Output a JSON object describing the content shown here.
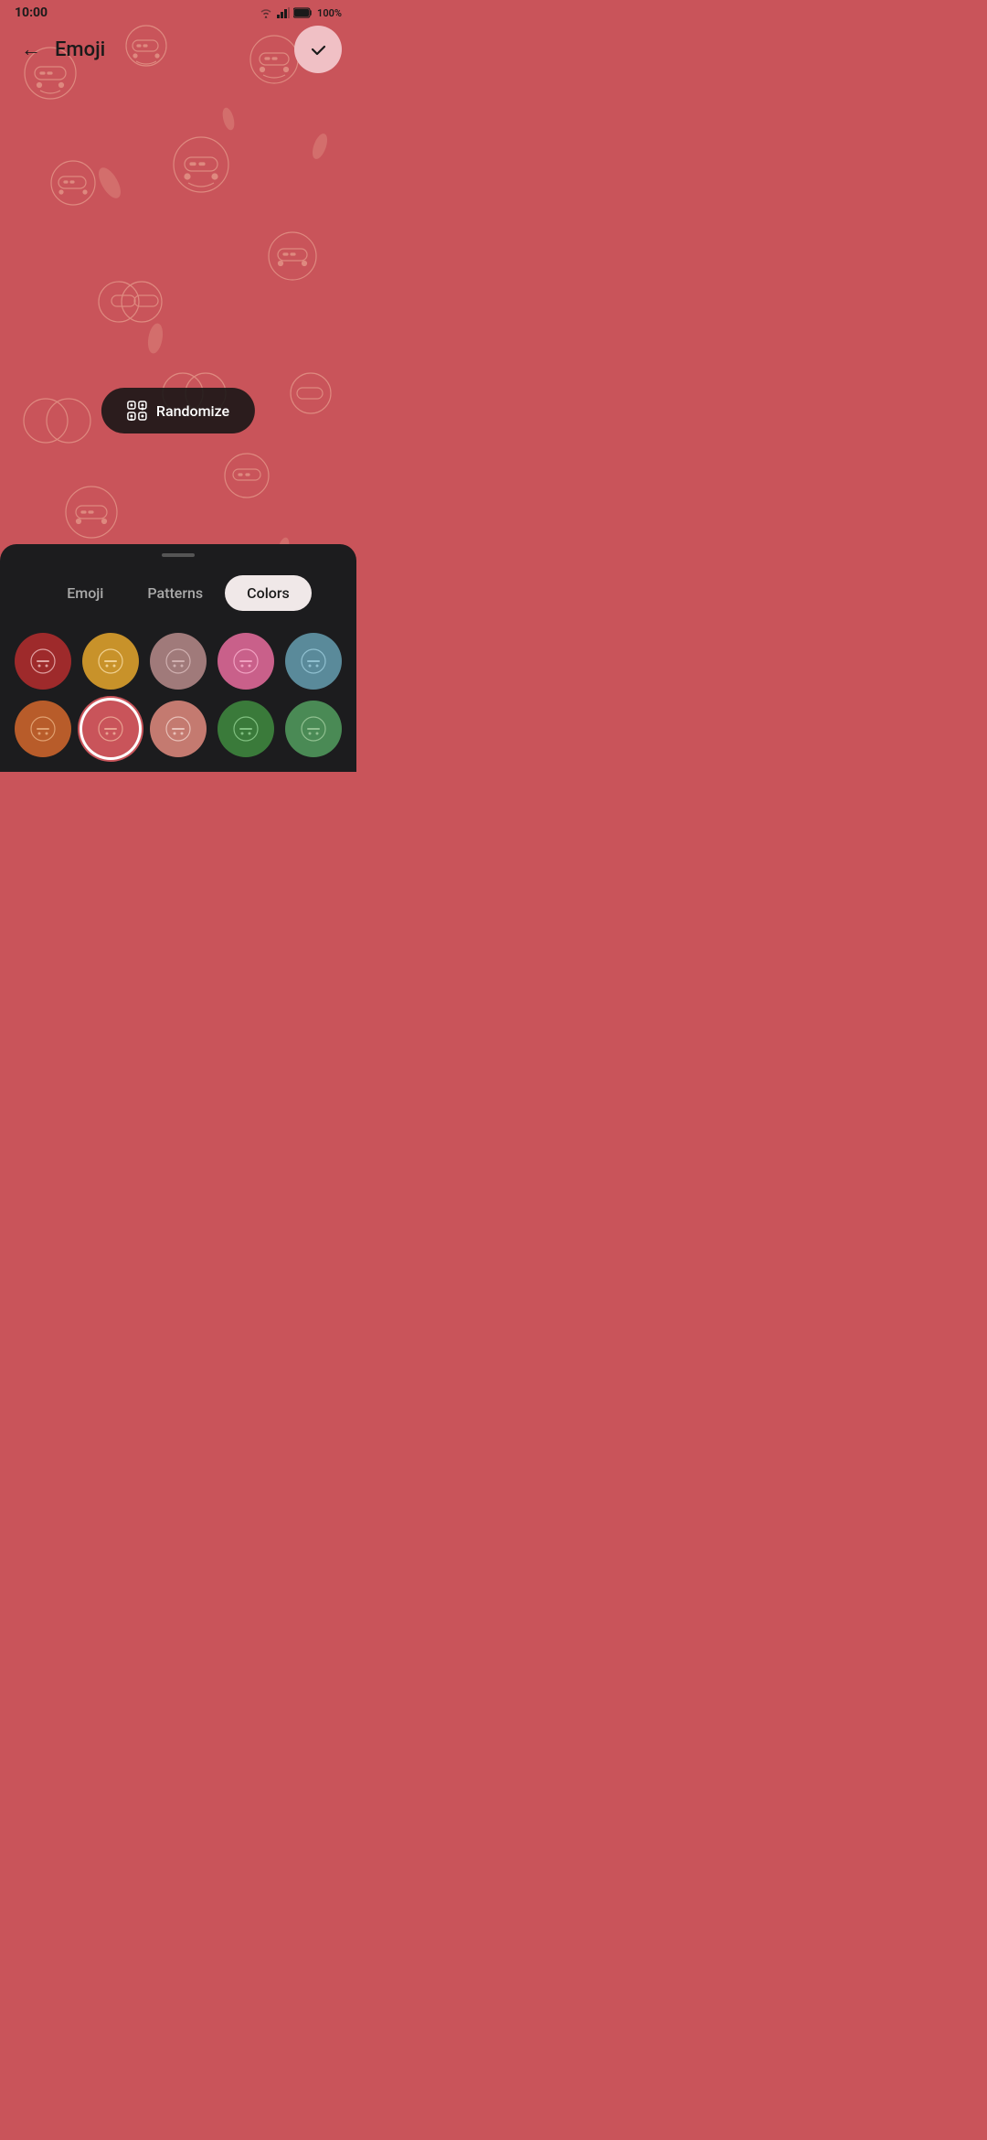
{
  "status": {
    "time": "10:00",
    "battery": "100%"
  },
  "header": {
    "back_label": "←",
    "title": "Emoji"
  },
  "randomize": {
    "label": "Randomize"
  },
  "tabs": [
    {
      "id": "emoji",
      "label": "Emoji",
      "active": false
    },
    {
      "id": "patterns",
      "label": "Patterns",
      "active": false
    },
    {
      "id": "colors",
      "label": "Colors",
      "active": true
    }
  ],
  "colors_row1": [
    {
      "id": "c1",
      "bg": "#9e2a2b",
      "selected": false
    },
    {
      "id": "c2",
      "bg": "#c8922a",
      "selected": false
    },
    {
      "id": "c3",
      "bg": "#a07a7a",
      "selected": false
    },
    {
      "id": "c4",
      "bg": "#c9608a",
      "selected": false
    },
    {
      "id": "c5",
      "bg": "#5a8a9a",
      "selected": false
    }
  ],
  "colors_row2": [
    {
      "id": "c6",
      "bg": "#b85c2a",
      "selected": false
    },
    {
      "id": "c7",
      "bg": "#c9545a",
      "selected": true
    },
    {
      "id": "c8",
      "bg": "#c47a70",
      "selected": false
    },
    {
      "id": "c9",
      "bg": "#3a7a3a",
      "selected": false
    },
    {
      "id": "c10",
      "bg": "#4a8a55",
      "selected": false
    }
  ]
}
